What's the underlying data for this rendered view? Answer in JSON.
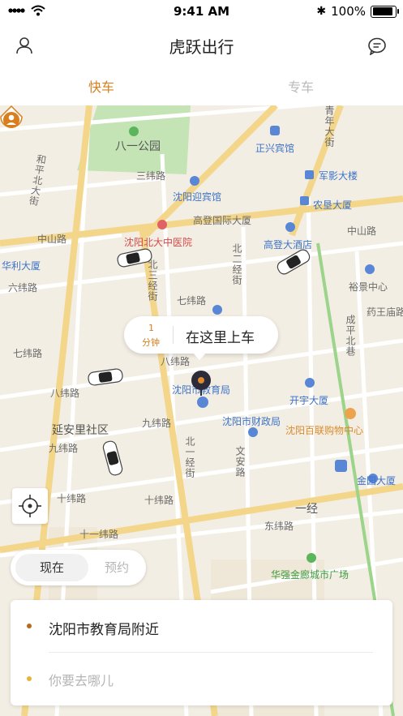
{
  "status_bar": {
    "time": "9:41 AM",
    "battery": "100%"
  },
  "header": {
    "title": "虎跃出行",
    "user_icon": "user-icon",
    "message_icon": "message-icon"
  },
  "tabs": [
    {
      "label": "快车",
      "active": true
    },
    {
      "label": "专车",
      "active": false
    }
  ],
  "map": {
    "labels": {
      "park": "八一公园",
      "hotel1": "正兴宾馆",
      "building1": "军影大楼",
      "hotel2": "沈阳迎宾馆",
      "building2": "农垦大厦",
      "road_zhongshan_w": "中山路",
      "road_zhongshan_e": "中山路",
      "building3": "高登国际大厦",
      "hospital": "沈阳北大中医院",
      "hotel3": "高登大酒店",
      "building4": "华利大厦",
      "building5": "裕景中心",
      "road_qiwei": "七纬路",
      "road_bawei": "八纬路",
      "road_jiuwei": "九纬路",
      "road_shiwei": "十纬路",
      "road_shiyiwei": "十一纬路",
      "road_sanwei": "三纬路",
      "road_liuwei": "六纬路",
      "road_qiwei_w": "七纬路",
      "road_bawei_w": "八纬路",
      "road_jiuwei_w": "九纬路",
      "road_shiwei_w": "十纬路",
      "building6": "开宇大厦",
      "finance": "沈阳市财政局",
      "edu": "沈阳市教育局",
      "mall": "沈阳百联购物中心",
      "community": "延安里社区",
      "garden": "金园大厦",
      "plaza": "华强金廊城市广场",
      "road_dongwei": "东纬路",
      "road_yijing": "一经",
      "road_heping": "和平北大街",
      "road_qingnian": "青年大街",
      "road_sanjing": "北三经街",
      "road_erjing": "北二经街",
      "road_yaowang": "药王庙路",
      "road_chengwai": "成平北巷",
      "road_wenan": "文安路",
      "road_beiyijing": "北一经街"
    }
  },
  "pickup": {
    "eta_value": "1",
    "eta_unit": "分钟",
    "label": "在这里上车"
  },
  "time_toggle": {
    "now": "现在",
    "later": "预约"
  },
  "trip": {
    "from": "沈阳市教育局附近",
    "to_placeholder": "你要去哪儿"
  },
  "colors": {
    "accent": "#d77f1e",
    "road": "#ffffff",
    "major_road": "#f5d57a",
    "park": "#bfe3b3"
  }
}
